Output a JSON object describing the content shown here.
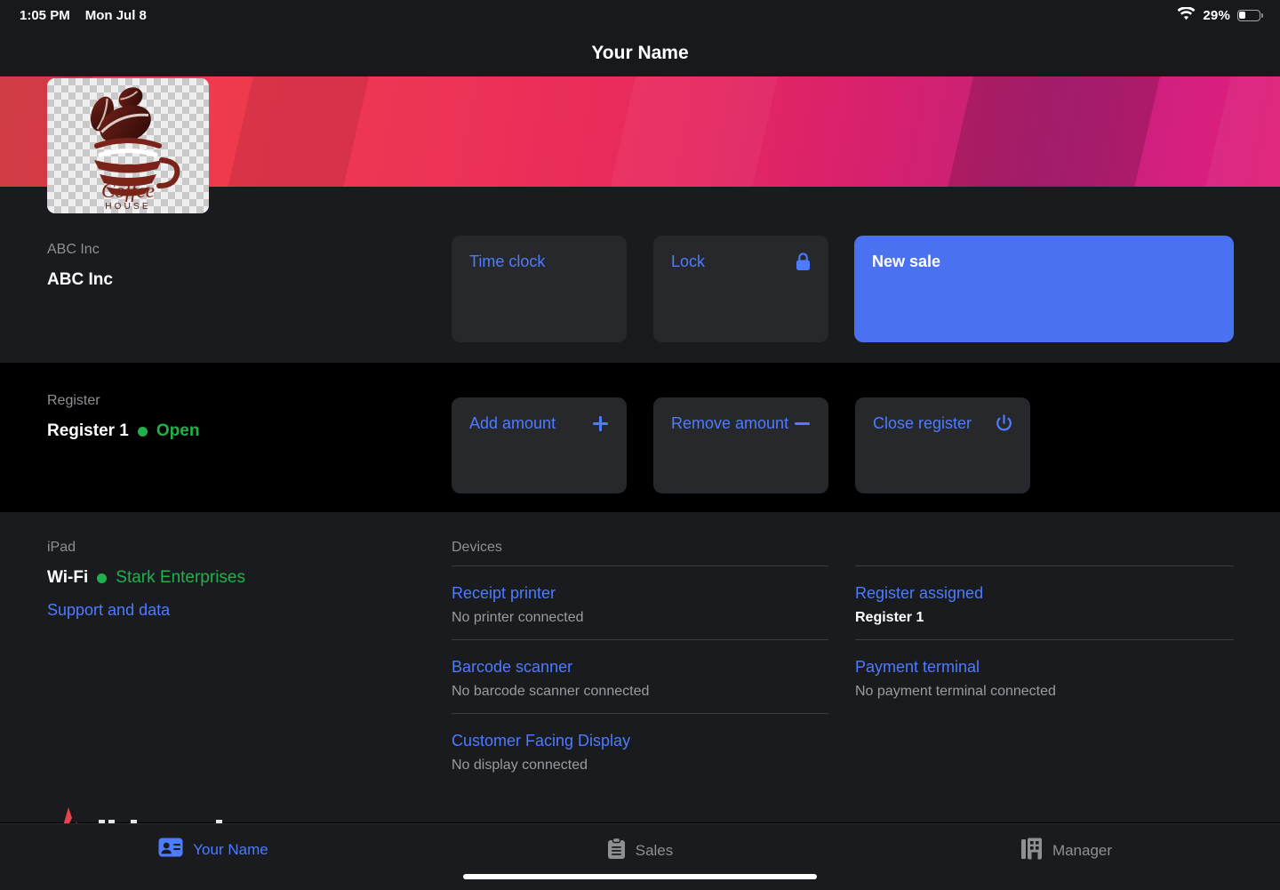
{
  "status_bar": {
    "time": "1:05 PM",
    "date": "Mon Jul 8",
    "battery_percent": "29%",
    "battery_level": 29,
    "wifi_icon": "wifi-icon",
    "battery_icon": "battery-icon"
  },
  "nav": {
    "title": "Your Name"
  },
  "hero": {
    "logo_alt": "Coffee House",
    "logo_text_main": "Coffee",
    "logo_text_sub": "HOUSE",
    "gradient_from": "#e8434f",
    "gradient_to": "#e01d79"
  },
  "merchant": {
    "label": "ABC Inc",
    "value": "ABC Inc"
  },
  "top_actions": [
    {
      "label": "Time clock",
      "icon": "",
      "style": "secondary"
    },
    {
      "label": "Lock",
      "icon": "lock-icon",
      "style": "secondary"
    },
    {
      "label": "New sale",
      "icon": "",
      "style": "primary"
    }
  ],
  "register": {
    "label": "Register",
    "name": "Register 1",
    "status": "Open",
    "status_color": "#21b14b",
    "actions": [
      {
        "label": "Add amount",
        "icon": "plus-icon"
      },
      {
        "label": "Remove amount",
        "icon": "minus-icon"
      },
      {
        "label": "Close register",
        "icon": "power-icon"
      }
    ]
  },
  "device_info": {
    "label": "iPad",
    "connection_type": "Wi-Fi",
    "network_name": "Stark Enterprises",
    "network_color": "#21b14b",
    "support_link": "Support and data"
  },
  "devices": {
    "heading": "Devices",
    "items": [
      {
        "title": "Receipt printer",
        "status": "No printer connected",
        "strong": false
      },
      {
        "title": "Barcode scanner",
        "status": "No barcode scanner connected",
        "strong": false
      },
      {
        "title": "Customer Facing Display",
        "status": "No display connected",
        "strong": false
      }
    ]
  },
  "register_column": {
    "heading": "",
    "items": [
      {
        "title": "Register assigned",
        "status": "Register 1",
        "strong": true
      },
      {
        "title": "Payment terminal",
        "status": "No payment terminal connected",
        "strong": false
      }
    ]
  },
  "tabs": [
    {
      "label": "Your Name",
      "icon": "contact-card-icon",
      "active": true
    },
    {
      "label": "Sales",
      "icon": "clipboard-icon",
      "active": false
    },
    {
      "label": "Manager",
      "icon": "storefront-icon",
      "active": false
    }
  ],
  "colors": {
    "accent_blue": "#4d7cfe",
    "primary_button": "#4a72f0",
    "tile_bg": "#26282c",
    "section_bg": "#1a1b1e",
    "muted_text": "#8e9094"
  }
}
